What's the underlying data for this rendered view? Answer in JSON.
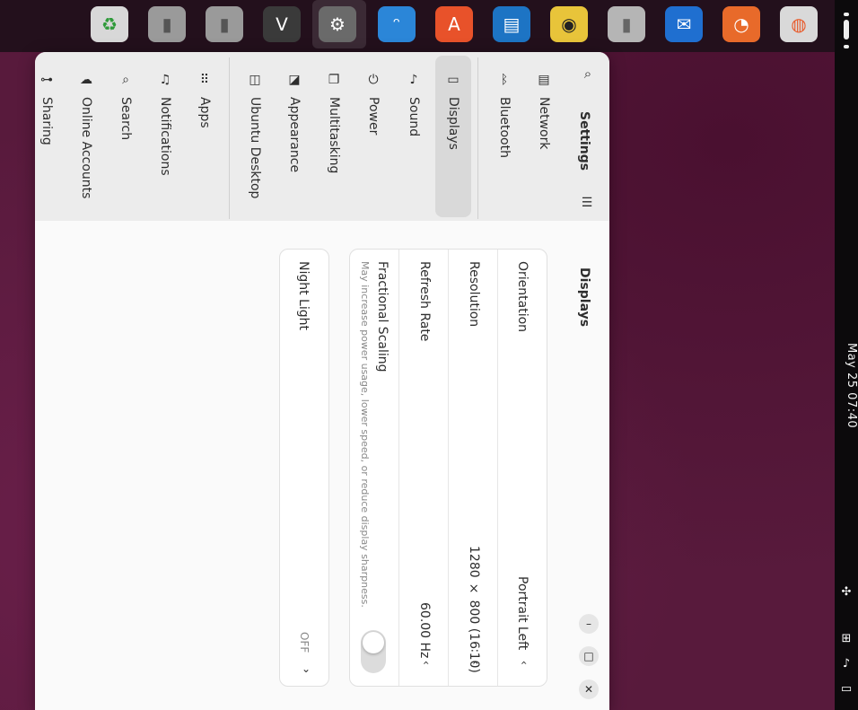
{
  "dock": {
    "apps": [
      {
        "name": "recycle-bin",
        "icon": "♻",
        "color": "#d8d8d8",
        "fg": "#2f9a3a"
      },
      {
        "name": "drive-1",
        "icon": "▮",
        "color": "#9a9a9a",
        "fg": "#555"
      },
      {
        "name": "drive-2",
        "icon": "▮",
        "color": "#9a9a9a",
        "fg": "#555"
      },
      {
        "name": "terminal",
        "icon": "ᐯ",
        "color": "#3a3a3a",
        "fg": "#fff"
      },
      {
        "name": "settings",
        "icon": "⚙",
        "color": "#6a6a6a",
        "fg": "#fff"
      },
      {
        "name": "shotwell",
        "icon": "ᵔ",
        "color": "#2b86d8",
        "fg": "#fff"
      },
      {
        "name": "software",
        "icon": "A",
        "color": "#e8522a",
        "fg": "#fff"
      },
      {
        "name": "libreoffice-impress",
        "icon": "▤",
        "color": "#1d74c4",
        "fg": "#fff"
      },
      {
        "name": "rhythmbox",
        "icon": "◉",
        "color": "#e8c43a",
        "fg": "#222"
      },
      {
        "name": "usb-drive",
        "icon": "▮",
        "color": "#b5b5b5",
        "fg": "#666"
      },
      {
        "name": "thunderbird",
        "icon": "✉",
        "color": "#1f6fd0",
        "fg": "#fff"
      },
      {
        "name": "firefox",
        "icon": "◔",
        "color": "#e86a2a",
        "fg": "#fff"
      },
      {
        "name": "ubuntu-installer",
        "icon": "◍",
        "color": "#d9d9d9",
        "fg": "#e85a2a"
      }
    ]
  },
  "panel": {
    "clock": "May 25  07:40",
    "tray": [
      "accessibility-icon",
      "network-icon",
      "volume-icon",
      "battery-icon"
    ]
  },
  "window": {
    "app_title": "Settings",
    "page_title": "Displays",
    "sidebar": [
      {
        "key": "network",
        "label": "Network",
        "icon": "▤"
      },
      {
        "key": "bluetooth",
        "label": "Bluetooth",
        "icon": "ᛒ"
      },
      {
        "key": "displays",
        "label": "Displays",
        "icon": "▭",
        "active": true
      },
      {
        "key": "sound",
        "label": "Sound",
        "icon": "♪"
      },
      {
        "key": "power",
        "label": "Power",
        "icon": "⏻"
      },
      {
        "key": "multitasking",
        "label": "Multitasking",
        "icon": "❐"
      },
      {
        "key": "appearance",
        "label": "Appearance",
        "icon": "◪"
      },
      {
        "key": "ubuntu-desktop",
        "label": "Ubuntu Desktop",
        "icon": "◫"
      },
      {
        "key": "apps",
        "label": "Apps",
        "icon": "⠿"
      },
      {
        "key": "notifications",
        "label": "Notifications",
        "icon": "♫"
      },
      {
        "key": "search",
        "label": "Search",
        "icon": "⌕"
      },
      {
        "key": "online-accounts",
        "label": "Online Accounts",
        "icon": "☁"
      },
      {
        "key": "sharing",
        "label": "Sharing",
        "icon": "⊶"
      }
    ],
    "display_settings": {
      "orientation": {
        "label": "Orientation",
        "value": "Portrait Left"
      },
      "resolution": {
        "label": "Resolution",
        "value": "1280 × 800 (16∶10)"
      },
      "refresh_rate": {
        "label": "Refresh Rate",
        "value": "60.00 Hz"
      },
      "fractional_scaling": {
        "label": "Fractional Scaling",
        "sub": "May increase power usage, lower speed, or reduce display sharpness.",
        "enabled": false
      }
    },
    "night_light": {
      "label": "Night Light",
      "value": "Off"
    }
  }
}
